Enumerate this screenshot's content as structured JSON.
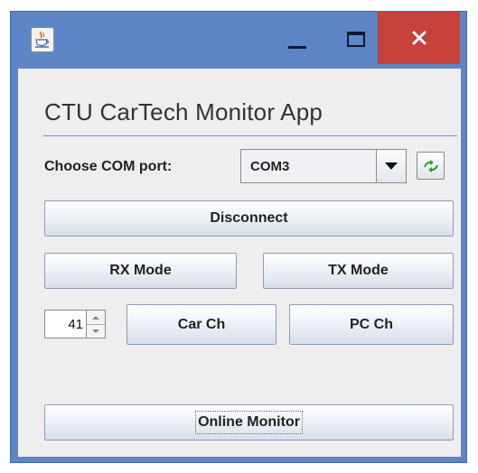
{
  "window": {
    "icon": "java-cup-icon",
    "controls": {
      "minimize": "minimize-icon",
      "maximize": "maximize-icon",
      "close": "close-icon"
    },
    "colors": {
      "frame": "#5e86c7",
      "close_button": "#c7423c",
      "content_bg": "#eeeeee"
    }
  },
  "app": {
    "title": "CTU CarTech Monitor App",
    "com_port": {
      "label": "Choose COM port:",
      "selected": "COM3",
      "refresh_icon": "refresh-icon"
    },
    "buttons": {
      "disconnect": "Disconnect",
      "rx_mode": "RX Mode",
      "tx_mode": "TX Mode",
      "car_ch": "Car Ch",
      "pc_ch": "PC Ch",
      "online_monitor": "Online Monitor"
    },
    "channel_spinner": {
      "value": "41"
    }
  }
}
